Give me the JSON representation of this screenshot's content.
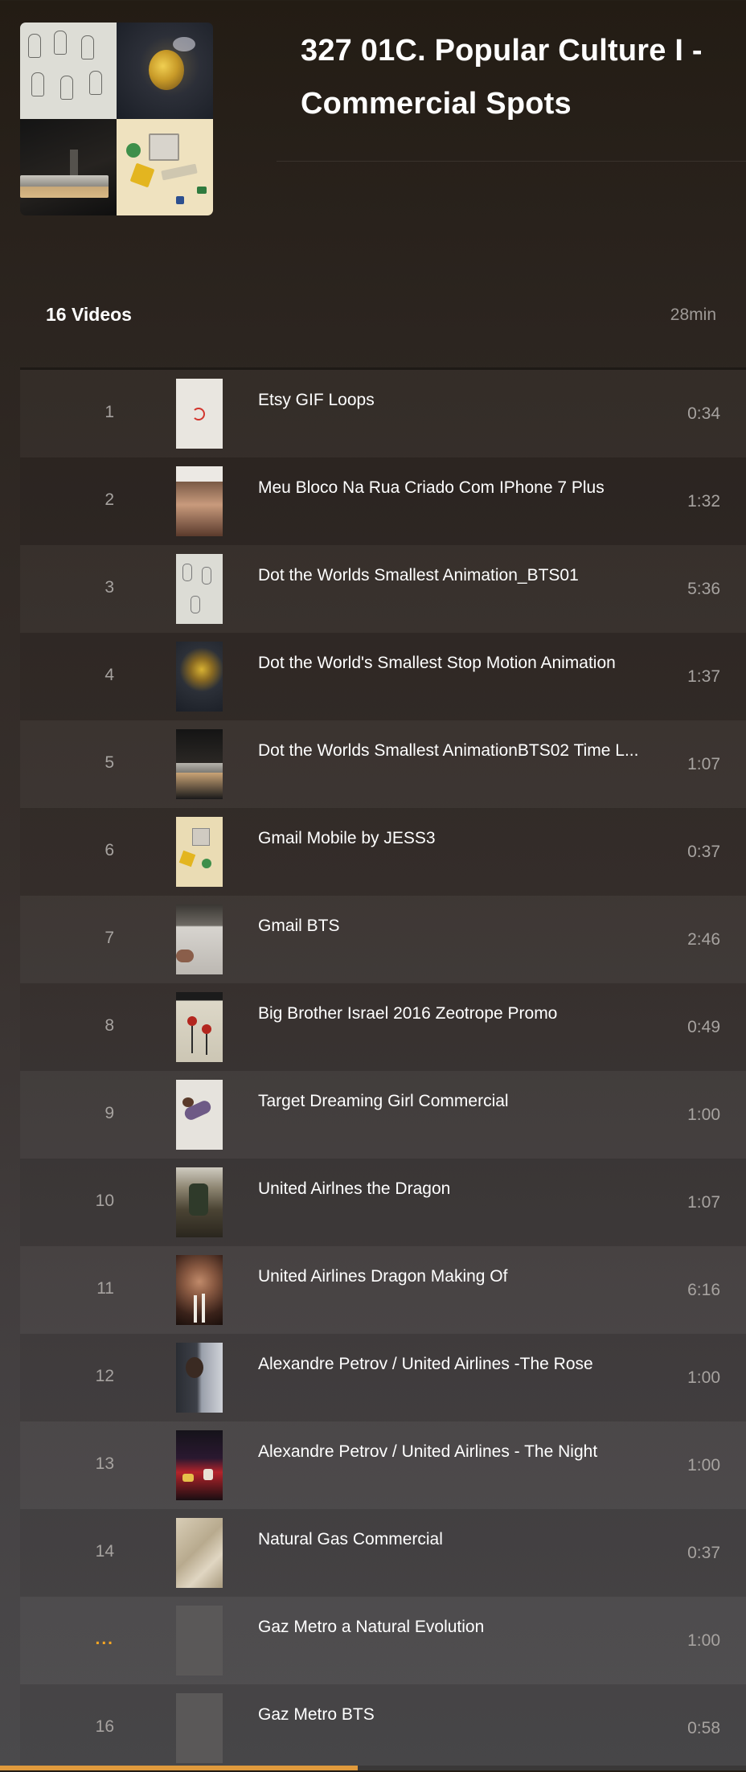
{
  "playlist": {
    "title": "327 01C. Popular Culture I - Commercial Spots",
    "video_count": "16 Videos",
    "total_duration": "28min"
  },
  "videos": [
    {
      "index": "1",
      "title": "Etsy GIF Loops",
      "duration": "0:34",
      "thumb": "paper-with-red-ring"
    },
    {
      "index": "2",
      "title": "Meu Bloco Na Rua Criado Com IPhone 7 Plus",
      "duration": "1:32",
      "thumb": "woman-portrait"
    },
    {
      "index": "3",
      "title": "Dot the Worlds Smallest Animation_BTS01",
      "duration": "5:36",
      "thumb": "pencil-sketches"
    },
    {
      "index": "4",
      "title": "Dot the World's Smallest Stop Motion Animation",
      "duration": "1:37",
      "thumb": "bee-figure"
    },
    {
      "index": "5",
      "title": "Dot the Worlds Smallest AnimationBTS02 Time L...",
      "duration": "1:07",
      "thumb": "studio-rig"
    },
    {
      "index": "6",
      "title": "Gmail Mobile by JESS3",
      "duration": "0:37",
      "thumb": "toy-blocks"
    },
    {
      "index": "7",
      "title": "Gmail BTS",
      "duration": "2:46",
      "thumb": "desk-papers"
    },
    {
      "index": "8",
      "title": "Big Brother Israel 2016 Zeotrope Promo",
      "duration": "0:49",
      "thumb": "red-flowers"
    },
    {
      "index": "9",
      "title": "Target Dreaming Girl Commercial",
      "duration": "1:00",
      "thumb": "floating-girl"
    },
    {
      "index": "10",
      "title": "United Airlnes the Dragon",
      "duration": "1:07",
      "thumb": "dragon-scene"
    },
    {
      "index": "11",
      "title": "United Airlines Dragon Making Of",
      "duration": "6:16",
      "thumb": "man-with-brush"
    },
    {
      "index": "12",
      "title": "Alexandre Petrov / United Airlines -The Rose",
      "duration": "1:00",
      "thumb": "painted-portrait"
    },
    {
      "index": "13",
      "title": "Alexandre Petrov / United Airlines - The Night",
      "duration": "1:00",
      "thumb": "night-painting"
    },
    {
      "index": "14",
      "title": "Natural Gas Commercial",
      "duration": "0:37",
      "thumb": "beige-surface"
    },
    {
      "index": "...",
      "title": "Gaz Metro a Natural Evolution",
      "duration": "1:00",
      "thumb": "blank",
      "now_playing": true
    },
    {
      "index": "16",
      "title": "Gaz Metro BTS",
      "duration": "0:58",
      "thumb": "blank"
    }
  ],
  "playback": {
    "progress_fraction": 0.48,
    "accent_color": "#e09a3c",
    "now_playing_color": "#f5a623"
  }
}
